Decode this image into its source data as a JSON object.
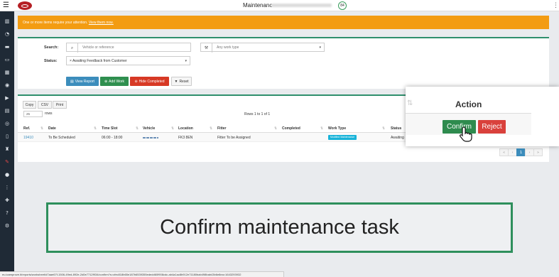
{
  "topbar": {
    "title": "Maintenanc",
    "badge": "84"
  },
  "alert": {
    "text": "One or more items require your attention.",
    "link": "View them now."
  },
  "filters": {
    "search_label": "Search:",
    "search_placeholder": "Vehicle or reference",
    "work_type_placeholder": "Any work type",
    "status_label": "Status:",
    "status_value": "× Awaiting Feedback from Customer"
  },
  "buttons": {
    "view_report": "View Report",
    "add_work": "Add Work",
    "hide_completed": "Hide Completed",
    "reset": "Reset"
  },
  "table": {
    "export_buttons": [
      "Copy",
      "CSV",
      "Print"
    ],
    "rows_value": "25",
    "rows_label": "rows",
    "info": "Rows 1 to 1 of 1",
    "columns": [
      "Ref.",
      "Date",
      "Time Slot",
      "Vehicle",
      "Location",
      "Fitter",
      "Completed",
      "Work Type",
      "Status"
    ],
    "row": {
      "ref": "19410",
      "date": "To Be Scheduled",
      "time_slot": "06:00 - 18:00",
      "location": "FK3 8EN",
      "fitter": "Fitter To be Assigned",
      "work_type": "Modified Maintenance",
      "status": "Awaiting"
    },
    "pager": [
      "«",
      "‹",
      "1",
      "›",
      "»"
    ]
  },
  "action_popup": {
    "title": "Action",
    "confirm": "Confirm",
    "reject": "Reject"
  },
  "caption": "Confirm maintenance task",
  "status_url": "eu.icamprove.it/reports/worksheet/d7aae67f-1506-49ed-892e-2d0e7712f934/confirm?s=cfec818b65e187b6539355ededd60f908cdc-ab4a1ac8b912e71180bab498bab43b6e8ea=1643293932",
  "colors": {
    "accent_green": "#2f8f6d",
    "alert_orange": "#f39c12",
    "primary_blue": "#3c8dbc",
    "danger_red": "#d73925",
    "sidebar": "#1f2a36"
  }
}
